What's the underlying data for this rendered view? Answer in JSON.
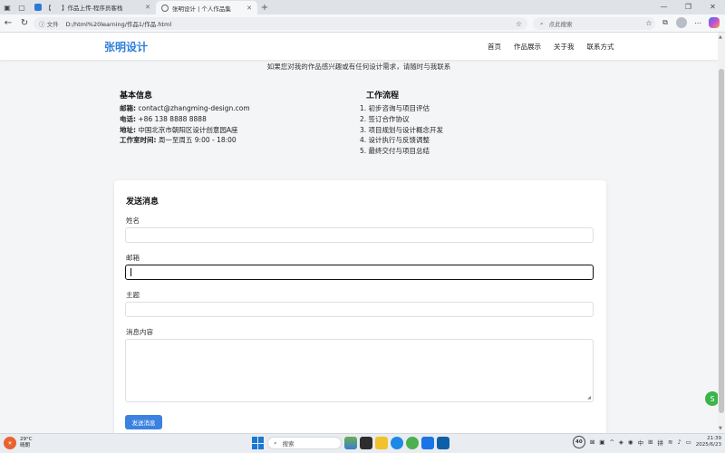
{
  "browser": {
    "tabs": [
      {
        "label": "【",
        "active": false
      },
      {
        "label": "】作品上传-程序员客栈",
        "active": false
      },
      {
        "label": "张明设计 | 个人作品集",
        "active": true
      }
    ],
    "address_label": "文件",
    "address": "D:/html%20learning/作品1/作品.html",
    "search_placeholder": "点此搜索"
  },
  "site": {
    "logo": "张明设计",
    "nav": [
      "首页",
      "作品展示",
      "关于我",
      "联系方式"
    ],
    "contact_intro": "如果您对我的作品感兴趣或有任何设计需求，请随时与我联系",
    "basic_info": {
      "title": "基本信息",
      "items": [
        {
          "label": "邮箱:",
          "value": " contact@zhangming-design.com"
        },
        {
          "label": "电话:",
          "value": " +86 138 8888 8888"
        },
        {
          "label": "地址:",
          "value": " 中国北京市朝阳区设计创意园A座"
        },
        {
          "label": "工作室时间:",
          "value": " 周一至周五 9:00 - 18:00"
        }
      ]
    },
    "workflow": {
      "title": "工作流程",
      "steps": [
        "1. 初步咨询与项目评估",
        "2. 签订合作协议",
        "3. 项目规划与设计概念开发",
        "4. 设计执行与反馈调整",
        "5. 最终交付与项目总结"
      ]
    },
    "form": {
      "title": "发送消息",
      "name_label": "姓名",
      "email_label": "邮箱",
      "subject_label": "主题",
      "message_label": "消息内容",
      "submit_label": "发送消息"
    }
  },
  "taskbar": {
    "temperature": "29°C",
    "weather": "晴朗",
    "search_label": "搜索",
    "badge": "40",
    "ime_1": "中",
    "ime_2": "拼",
    "time": "21:39",
    "date": "2025/6/23"
  },
  "colors": {
    "accent": "#2f7fd8",
    "button": "#3b82e0",
    "page_bg": "#f4f5f7"
  }
}
